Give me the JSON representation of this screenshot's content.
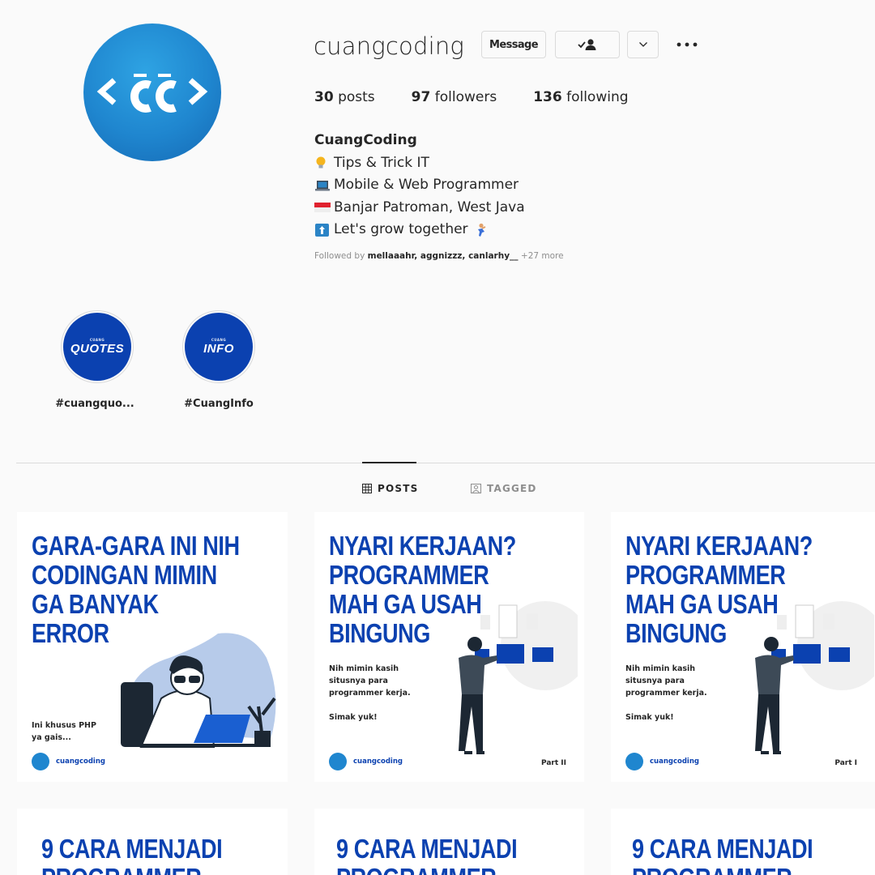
{
  "profile": {
    "username": "cuangcoding",
    "avatar_text": "<CC>",
    "message_label": "Message",
    "stats": {
      "posts_count": "30",
      "posts_label": "posts",
      "followers_count": "97",
      "followers_label": "followers",
      "following_count": "136",
      "following_label": "following"
    },
    "bio": {
      "name": "CuangCoding",
      "lines": [
        "Tips & Trick IT",
        "Mobile & Web Programmer",
        "Banjar Patroman, West Java",
        "Let's grow together"
      ]
    },
    "followed_by": {
      "prefix": "Followed by",
      "names": "mellaaahr, aggnizzz, canlarhy__",
      "more": "+27 more"
    }
  },
  "highlights": [
    {
      "small": "CUANG",
      "big": "QUOTES",
      "label": "#cuangquo..."
    },
    {
      "small": "CUANG",
      "big": "INFO",
      "label": "#CuangInfo"
    }
  ],
  "tabs": [
    {
      "label": "POSTS",
      "active": true
    },
    {
      "label": "TAGGED",
      "active": false
    }
  ],
  "posts": [
    {
      "title": [
        "GARA-GARA INI NIH",
        "CODINGAN MIMIN",
        "GA BANYAK",
        "ERROR"
      ],
      "sub": [
        "Ini khusus PHP",
        "ya gais..."
      ],
      "footer": "cuangcoding",
      "part": ""
    },
    {
      "title": [
        "NYARI KERJAAN?",
        "PROGRAMMER",
        "MAH GA USAH",
        "BINGUNG"
      ],
      "sub": [
        "Nih mimin kasih",
        "situsnya para",
        "programmer kerja.",
        "",
        "Simak yuk!"
      ],
      "footer": "cuangcoding",
      "part": "Part II"
    },
    {
      "title": [
        "NYARI KERJAAN?",
        "PROGRAMMER",
        "MAH GA USAH",
        "BINGUNG"
      ],
      "sub": [
        "Nih mimin kasih",
        "situsnya para",
        "programmer kerja.",
        "",
        "Simak yuk!"
      ],
      "footer": "cuangcoding",
      "part": "Part I"
    },
    {
      "title": [
        "9 CARA MENJADI",
        "PROGRAMMER"
      ],
      "sub": [],
      "footer": "",
      "part": ""
    },
    {
      "title": [
        "9 CARA MENJADI",
        "PROGRAMMER"
      ],
      "sub": [],
      "footer": "",
      "part": ""
    },
    {
      "title": [
        "9 CARA MENJADI",
        "PROGRAMMER"
      ],
      "sub": [],
      "footer": "",
      "part": ""
    }
  ],
  "colors": {
    "brand_blue": "#0b41b0",
    "avatar_blue": "#1f86cf",
    "text": "#262626",
    "muted": "#8e8e8e",
    "border": "#dbdbdb"
  }
}
